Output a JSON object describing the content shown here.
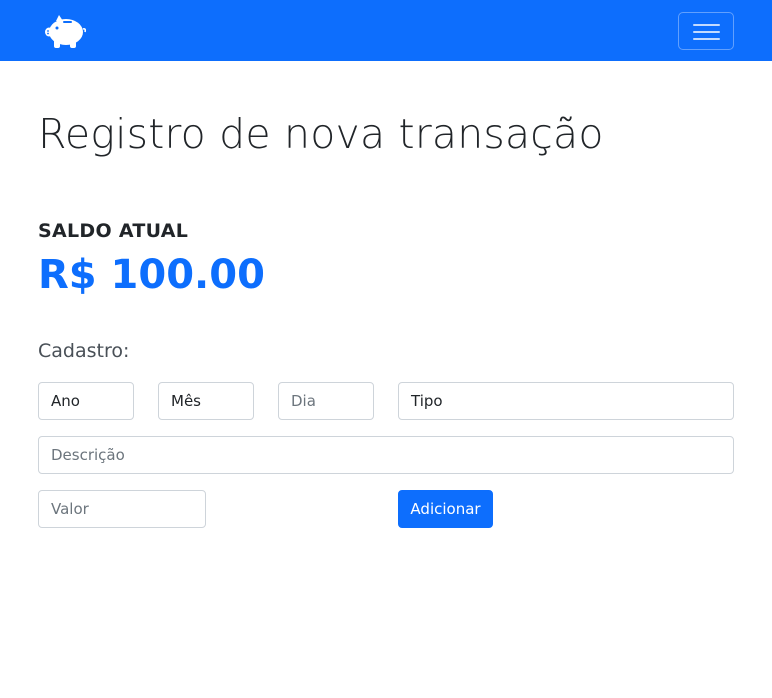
{
  "navbar": {
    "logo_icon": "piggy-bank-icon",
    "toggle_icon": "hamburger-menu-icon",
    "color": "#0d6efd"
  },
  "page": {
    "title": "Registro de nova transação"
  },
  "balance": {
    "label": "SALDO ATUAL",
    "value": "R$ 100.00",
    "color": "#0d6efd"
  },
  "form": {
    "label": "Cadastro:",
    "ano": "Ano",
    "mes": "Mês",
    "dia_placeholder": "Dia",
    "tipo": "Tipo",
    "descricao_placeholder": "Descrição",
    "valor_placeholder": "Valor",
    "submit_label": "Adicionar"
  }
}
